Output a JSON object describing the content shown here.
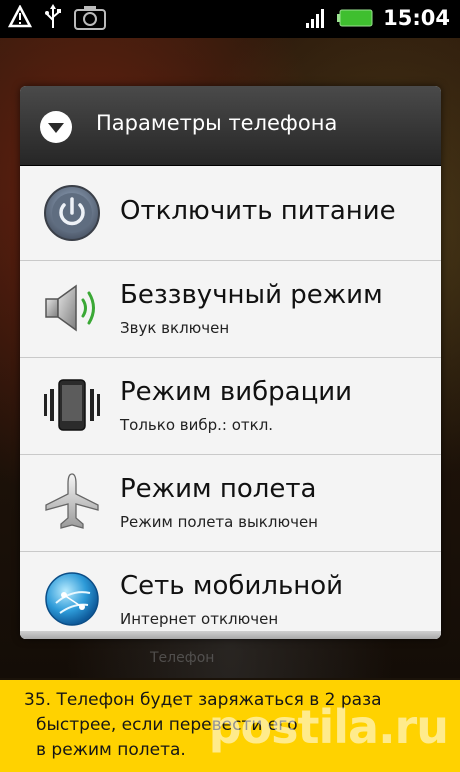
{
  "status_bar": {
    "time": "15:04",
    "icons": [
      "warning-icon",
      "usb-icon",
      "camera-icon",
      "signal-icon",
      "battery-icon"
    ]
  },
  "background": {
    "hint_text": "Телефон"
  },
  "dialog": {
    "title": "Параметры телефона",
    "items": [
      {
        "icon": "power-icon",
        "title": "Отключить питание",
        "subtitle": ""
      },
      {
        "icon": "speaker-icon",
        "title": "Беззвучный режим",
        "subtitle": "Звук включен"
      },
      {
        "icon": "vibrate-phone-icon",
        "title": "Режим вибрации",
        "subtitle": "Только вибр.: откл."
      },
      {
        "icon": "airplane-icon",
        "title": "Режим полета",
        "subtitle": "Режим полета выключен"
      },
      {
        "icon": "globe-icon",
        "title": "Сеть мобильной",
        "subtitle": "Интернет отключен"
      }
    ]
  },
  "caption": {
    "lines": [
      "35. Телефон будет заряжаться в 2 раза",
      "быстрее, если перевести его",
      "в режим полета."
    ]
  },
  "watermark": "postila.ru",
  "colors": {
    "caption_background": "#ffd200",
    "header_background": "#333333",
    "dialog_background": "#f4f4f4",
    "battery": "#3fbf2f"
  }
}
